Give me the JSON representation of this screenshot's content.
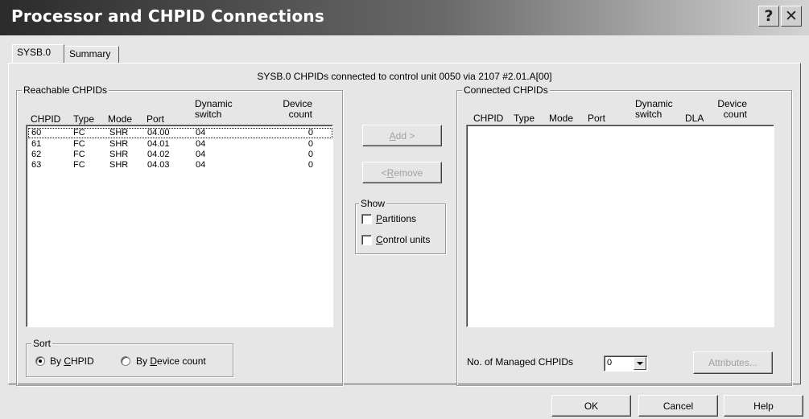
{
  "window": {
    "title": "Processor and CHPID Connections",
    "help_label": "?",
    "close_label": "✕"
  },
  "tabs": [
    {
      "label": "SYSB.0",
      "active": true
    },
    {
      "label": "Summary",
      "active": false
    }
  ],
  "connection_message": "SYSB.0 CHPIDs connected to control unit 0050 via 2107 #2.01.A[00]",
  "reachable": {
    "group_label": "Reachable CHPIDs",
    "headers": {
      "chpid": "CHPID",
      "type": "Type",
      "mode": "Mode",
      "port": "Port",
      "dynamic_switch_1": "Dynamic",
      "dynamic_switch_2": "switch",
      "device_count_1": "Device",
      "device_count_2": "count"
    },
    "rows": [
      {
        "chpid": "60",
        "type": "FC",
        "mode": "SHR",
        "port": "04.00",
        "dynamic_switch": "04",
        "device_count": "0"
      },
      {
        "chpid": "61",
        "type": "FC",
        "mode": "SHR",
        "port": "04.01",
        "dynamic_switch": "04",
        "device_count": "0"
      },
      {
        "chpid": "62",
        "type": "FC",
        "mode": "SHR",
        "port": "04.02",
        "dynamic_switch": "04",
        "device_count": "0"
      },
      {
        "chpid": "63",
        "type": "FC",
        "mode": "SHR",
        "port": "04.03",
        "dynamic_switch": "04",
        "device_count": "0"
      }
    ]
  },
  "sort": {
    "group_label": "Sort",
    "by_chpid_pre": "By ",
    "by_chpid_key": "C",
    "by_chpid_post": "HPID",
    "by_device_pre": "By ",
    "by_device_key": "D",
    "by_device_post": "evice count",
    "selected": "chpid"
  },
  "actions": {
    "add_pre": "",
    "add_key": "A",
    "add_post": "dd >",
    "remove_pre": "< ",
    "remove_key": "R",
    "remove_post": "emove"
  },
  "show": {
    "group_label": "Show",
    "partitions_key": "P",
    "partitions_post": "artitions",
    "control_units_key": "C",
    "control_units_post": "ontrol units"
  },
  "connected": {
    "group_label": "Connected CHPIDs",
    "headers": {
      "chpid": "CHPID",
      "type": "Type",
      "mode": "Mode",
      "port": "Port",
      "dynamic_switch_1": "Dynamic",
      "dynamic_switch_2": "switch",
      "dla": "DLA",
      "device_count_1": "Device",
      "device_count_2": "count"
    },
    "rows": []
  },
  "managed": {
    "label": "No. of Managed CHPIDs",
    "value": "0",
    "attributes_label": "Attributes..."
  },
  "footer": {
    "ok_label": "OK",
    "cancel_label": "Cancel",
    "help_label": "Help"
  }
}
